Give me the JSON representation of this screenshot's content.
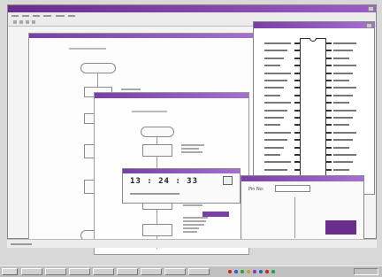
{
  "clock": {
    "time": "13 : 24 : 33"
  },
  "chip": {
    "field_label": "Pin No:"
  },
  "colors": {
    "titlebar": "#7a3ea8",
    "desktop": "#d8d8d8",
    "taskbar": "#c0c0c0"
  }
}
